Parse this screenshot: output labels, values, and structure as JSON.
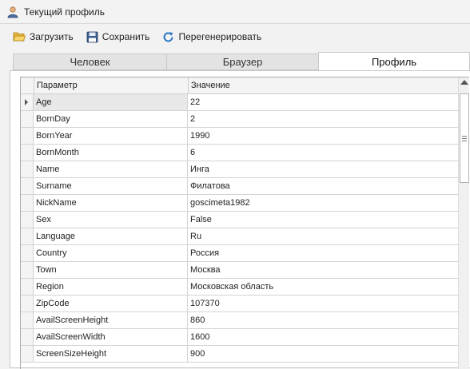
{
  "window": {
    "title": "Текущий профиль"
  },
  "toolbar": {
    "load_label": "Загрузить",
    "save_label": "Сохранить",
    "regenerate_label": "Перегенерировать"
  },
  "tabs": [
    {
      "label": "Человек",
      "active": false
    },
    {
      "label": "Браузер",
      "active": false
    },
    {
      "label": "Профиль",
      "active": true
    }
  ],
  "grid": {
    "columns": {
      "param": "Параметр",
      "value": "Значение"
    },
    "rows": [
      {
        "key": "Age",
        "value": "22"
      },
      {
        "key": "BornDay",
        "value": "2"
      },
      {
        "key": "BornYear",
        "value": "1990"
      },
      {
        "key": "BornMonth",
        "value": "6"
      },
      {
        "key": "Name",
        "value": "Инга"
      },
      {
        "key": "Surname",
        "value": "Филатова"
      },
      {
        "key": "NickName",
        "value": "goscimeta1982"
      },
      {
        "key": "Sex",
        "value": "False"
      },
      {
        "key": "Language",
        "value": "Ru"
      },
      {
        "key": "Country",
        "value": "Россия"
      },
      {
        "key": "Town",
        "value": "Москва"
      },
      {
        "key": "Region",
        "value": "Московская область"
      },
      {
        "key": "ZipCode",
        "value": "107370"
      },
      {
        "key": "AvailScreenHeight",
        "value": "860"
      },
      {
        "key": "AvailScreenWidth",
        "value": "1600"
      },
      {
        "key": "ScreenSizeHeight",
        "value": "900"
      }
    ]
  },
  "colors": {
    "accent": "#2b6cb0",
    "active_tab": "#ffffff",
    "grid_line": "#d4d4d4"
  }
}
